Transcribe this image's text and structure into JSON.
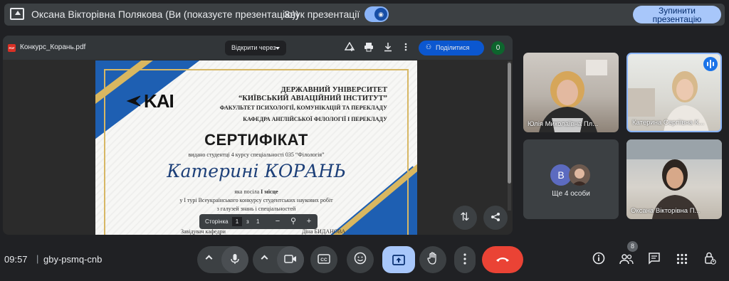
{
  "banner": {
    "presenter_text": "Оксана Вікторівна Полякова (Ви (показуєте презентацію))",
    "sound_label": "Звук презентації",
    "stop_button": "Зупинити презентацію"
  },
  "doc": {
    "filename": "Конкурс_Корань.pdf",
    "open_with": "Відкрити через",
    "share": "Поділитися",
    "viewer_count": "0"
  },
  "certificate": {
    "logo_text": "KAI",
    "university_line1": "ДЕРЖАВНИЙ УНІВЕРСИТЕТ",
    "university_line2": "“КИЇВСЬКИЙ АВІАЦІЙНИЙ ІНСТИТУТ”",
    "faculty": "ФАКУЛЬТЕТ ПСИХОЛОГІЇ, КОМУНІКАЦІЙ ТА ПЕРЕКЛАДУ",
    "department": "КАФЕДРА АНГЛІЙСЬКОЇ ФІЛОЛОГІЇ І ПЕРЕКЛАДУ",
    "title": "СЕРТИФІКАТ",
    "issued_to": "видано студентці 4 курсу спеціальності 035 “Філологія”",
    "recipient": "Катерині КОРАНЬ",
    "place_prefix": "яка посіла",
    "place": "І місце",
    "round_line": "у І турі Всеукраїнського конкурсу студентських наукових робіт",
    "field_line": "з галузей знань і спеціальностей",
    "head_line": "Завідувач кафедри",
    "signature_name": "Діна БИДАНОВА"
  },
  "page_bar": {
    "label": "Сторінка",
    "current": "1",
    "separator": "з",
    "total": "1"
  },
  "participants": [
    {
      "name": "Юлія Миколаївна Пл..."
    },
    {
      "name": "Катерина Сергіївна К..."
    },
    {
      "name": "Оксана Вікторівна П..."
    }
  ],
  "more_people": {
    "initial": "В",
    "label": "Ще 4 особи"
  },
  "bottom": {
    "time": "09:57",
    "divider": "|",
    "meeting_code": "gby-psmq-cnb",
    "people_count": "8"
  },
  "colors": {
    "background": "#202124",
    "accent": "#a8c7fa",
    "end_call": "#ea4335",
    "share_blue": "#0b57d0"
  }
}
